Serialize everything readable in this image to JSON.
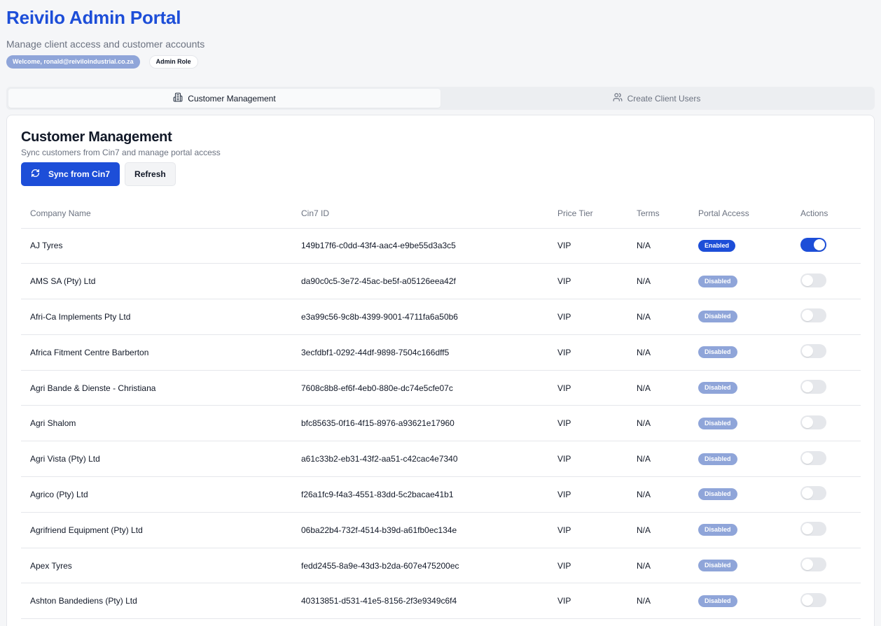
{
  "header": {
    "title": "Reivilo Admin Portal",
    "subtitle": "Manage client access and customer accounts",
    "welcome_badge": "Welcome, ronald@reiviloindustrial.co.za",
    "role_badge": "Admin Role"
  },
  "tabs": [
    {
      "label": "Customer Management",
      "icon": "building-icon",
      "active": true
    },
    {
      "label": "Create Client Users",
      "icon": "users-icon",
      "active": false
    }
  ],
  "card": {
    "title": "Customer Management",
    "description": "Sync customers from Cin7 and manage portal access",
    "sync_button": "Sync from Cin7",
    "refresh_button": "Refresh"
  },
  "table": {
    "columns": [
      "Company Name",
      "Cin7 ID",
      "Price Tier",
      "Terms",
      "Portal Access",
      "Actions"
    ],
    "rows": [
      {
        "company": "AJ Tyres",
        "cin7_id": "149b17f6-c0dd-43f4-aac4-e9be55d3a3c5",
        "tier": "VIP",
        "terms": "N/A",
        "access": "Enabled",
        "enabled": true
      },
      {
        "company": "AMS SA (Pty) Ltd",
        "cin7_id": "da90c0c5-3e72-45ac-be5f-a05126eea42f",
        "tier": "VIP",
        "terms": "N/A",
        "access": "Disabled",
        "enabled": false
      },
      {
        "company": "Afri-Ca Implements Pty Ltd",
        "cin7_id": "e3a99c56-9c8b-4399-9001-4711fa6a50b6",
        "tier": "VIP",
        "terms": "N/A",
        "access": "Disabled",
        "enabled": false
      },
      {
        "company": "Africa Fitment Centre Barberton",
        "cin7_id": "3ecfdbf1-0292-44df-9898-7504c166dff5",
        "tier": "VIP",
        "terms": "N/A",
        "access": "Disabled",
        "enabled": false
      },
      {
        "company": "Agri Bande & Dienste - Christiana",
        "cin7_id": "7608c8b8-ef6f-4eb0-880e-dc74e5cfe07c",
        "tier": "VIP",
        "terms": "N/A",
        "access": "Disabled",
        "enabled": false
      },
      {
        "company": "Agri Shalom",
        "cin7_id": "bfc85635-0f16-4f15-8976-a93621e17960",
        "tier": "VIP",
        "terms": "N/A",
        "access": "Disabled",
        "enabled": false
      },
      {
        "company": "Agri Vista (Pty) Ltd",
        "cin7_id": "a61c33b2-eb31-43f2-aa51-c42cac4e7340",
        "tier": "VIP",
        "terms": "N/A",
        "access": "Disabled",
        "enabled": false
      },
      {
        "company": "Agrico (Pty) Ltd",
        "cin7_id": "f26a1fc9-f4a3-4551-83dd-5c2bacae41b1",
        "tier": "VIP",
        "terms": "N/A",
        "access": "Disabled",
        "enabled": false
      },
      {
        "company": "Agrifriend Equipment (Pty) Ltd",
        "cin7_id": "06ba22b4-732f-4514-b39d-a61fb0ec134e",
        "tier": "VIP",
        "terms": "N/A",
        "access": "Disabled",
        "enabled": false
      },
      {
        "company": "Apex Tyres",
        "cin7_id": "fedd2455-8a9e-43d3-b2da-607e475200ec",
        "tier": "VIP",
        "terms": "N/A",
        "access": "Disabled",
        "enabled": false
      },
      {
        "company": "Ashton Bandediens (Pty) Ltd",
        "cin7_id": "40313851-d531-41e5-8156-2f3e9349c6f4",
        "tier": "VIP",
        "terms": "N/A",
        "access": "Disabled",
        "enabled": false
      }
    ]
  },
  "colors": {
    "brand": "#1d4ed8",
    "badge_muted": "#8fa5d9",
    "toggle_off": "#e5e7eb"
  }
}
